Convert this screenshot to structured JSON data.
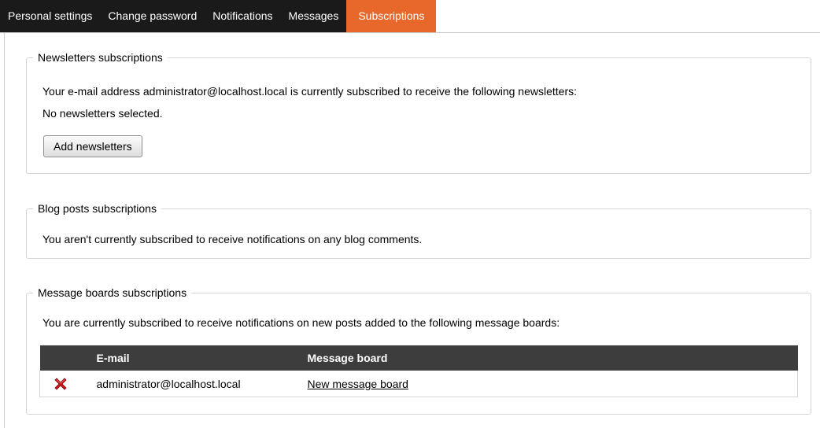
{
  "tabs": [
    {
      "label": "Personal settings",
      "active": false
    },
    {
      "label": "Change password",
      "active": false
    },
    {
      "label": "Notifications",
      "active": false
    },
    {
      "label": "Messages",
      "active": false
    },
    {
      "label": "Subscriptions",
      "active": true
    }
  ],
  "colors": {
    "tab_bar": "#1a1a1a",
    "tab_active": "#e8672a",
    "table_header": "#3d3d3d",
    "delete_icon": "#c8171c"
  },
  "newsletters": {
    "legend": "Newsletters subscriptions",
    "text": "Your e-mail address administrator@localhost.local is currently subscribed to receive the following newsletters:",
    "empty_text": "No newsletters selected.",
    "add_button": "Add newsletters"
  },
  "blog": {
    "legend": "Blog posts subscriptions",
    "text": "You aren't currently subscribed to receive notifications on any blog comments."
  },
  "boards": {
    "legend": "Message boards subscriptions",
    "text": "You are currently subscribed to receive notifications on new posts added to the following message boards:",
    "table": {
      "headers": [
        "",
        "E-mail",
        "Message board"
      ],
      "rows": [
        {
          "action_icon": "delete-icon",
          "email": "administrator@localhost.local",
          "board": "New message board"
        }
      ]
    }
  }
}
